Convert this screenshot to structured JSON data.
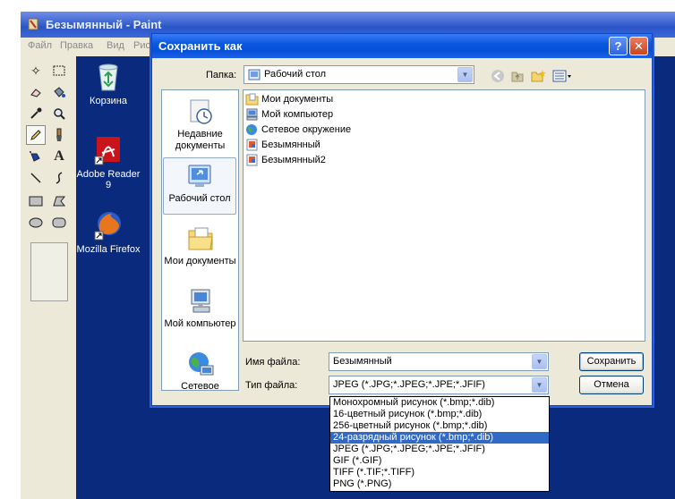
{
  "paint": {
    "title": "Безымянный - Paint",
    "menu": [
      "Файл",
      "Правка",
      "Вид",
      "Рис"
    ]
  },
  "desktop": {
    "icons": [
      {
        "label": "Корзина",
        "icon": "recycle-bin-icon"
      },
      {
        "label": "Adobe Reader 9",
        "icon": "adobe-reader-icon"
      },
      {
        "label": "Mozilla Firefox",
        "icon": "firefox-icon"
      }
    ]
  },
  "dialog": {
    "title": "Сохранить как",
    "help_label": "?",
    "close_label": "✕",
    "folder_label": "Папка:",
    "folder_value": "Рабочий стол",
    "places": [
      {
        "label": "Недавние документы",
        "icon": "recent-documents-icon"
      },
      {
        "label": "Рабочий стол",
        "icon": "desktop-icon"
      },
      {
        "label": "Мои документы",
        "icon": "my-documents-icon"
      },
      {
        "label": "Мой компьютер",
        "icon": "my-computer-icon"
      },
      {
        "label": "Сетевое",
        "icon": "network-icon"
      }
    ],
    "files": [
      {
        "name": "Мои документы",
        "icon": "folder-documents-icon"
      },
      {
        "name": "Мой компьютер",
        "icon": "computer-icon"
      },
      {
        "name": "Сетевое окружение",
        "icon": "network-places-icon"
      },
      {
        "name": "Безымянный",
        "icon": "image-file-icon"
      },
      {
        "name": "Безымянный2",
        "icon": "image-file-icon"
      }
    ],
    "filename_label": "Имя файла:",
    "filename_value": "Безымянный",
    "filetype_label": "Тип файла:",
    "filetype_value": "JPEG (*.JPG;*.JPEG;*.JPE;*.JFIF)",
    "save_label": "Сохранить",
    "cancel_label": "Отмена",
    "filetype_options": [
      "Монохромный рисунок (*.bmp;*.dib)",
      "16-цветный рисунок (*.bmp;*.dib)",
      "256-цветный рисунок (*.bmp;*.dib)",
      "24-разрядный рисунок (*.bmp;*.dib)",
      "JPEG (*.JPG;*.JPEG;*.JPE;*.JFIF)",
      "GIF (*.GIF)",
      "TIFF (*.TIF;*.TIFF)",
      "PNG (*.PNG)"
    ],
    "highlighted_option": "24-разрядный рисунок (*.bmp;*.dib)"
  },
  "colors": {
    "desktop_blue": "#0a2b7d",
    "dialog_title": "#0550d8",
    "selection": "#316ac5"
  }
}
